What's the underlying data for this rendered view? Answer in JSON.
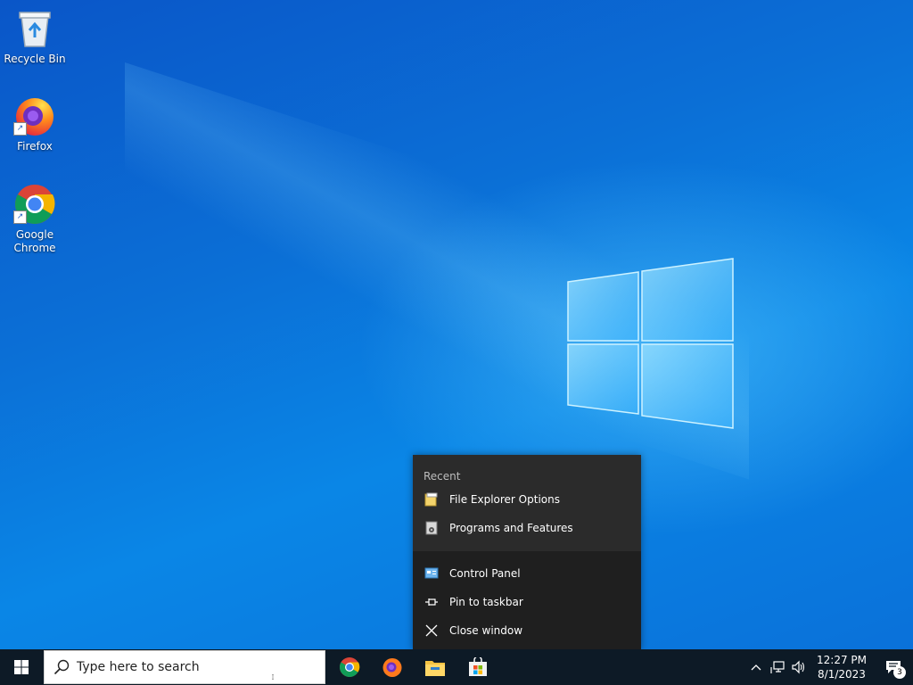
{
  "desktop": {
    "icons": [
      {
        "label": "Recycle Bin",
        "icon": "recycle-bin-icon"
      },
      {
        "label": "Firefox",
        "icon": "firefox-icon"
      },
      {
        "label": "Google Chrome",
        "icon": "chrome-icon"
      }
    ]
  },
  "jumplist": {
    "recent_heading": "Recent",
    "recent_items": [
      {
        "label": "File Explorer Options",
        "icon": "folder-options-icon"
      },
      {
        "label": "Programs and Features",
        "icon": "programs-features-icon"
      }
    ],
    "actions": [
      {
        "label": "Control Panel",
        "icon": "control-panel-icon"
      },
      {
        "label": "Pin to taskbar",
        "icon": "pin-icon"
      },
      {
        "label": "Close window",
        "icon": "close-icon"
      }
    ]
  },
  "taskbar": {
    "search_placeholder": "Type here to search",
    "pinned_apps": [
      {
        "name": "Google Chrome",
        "icon": "chrome-icon"
      },
      {
        "name": "Firefox",
        "icon": "firefox-icon"
      },
      {
        "name": "File Explorer",
        "icon": "file-explorer-icon"
      },
      {
        "name": "Microsoft Store",
        "icon": "store-icon"
      }
    ],
    "clock": {
      "time": "12:27 PM",
      "date": "8/1/2023"
    },
    "notification_count": "3"
  },
  "colors": {
    "desktop_blue": "#0a6fd8",
    "taskbar": "#0d1a26",
    "jumplist": "#2b2b2b"
  }
}
